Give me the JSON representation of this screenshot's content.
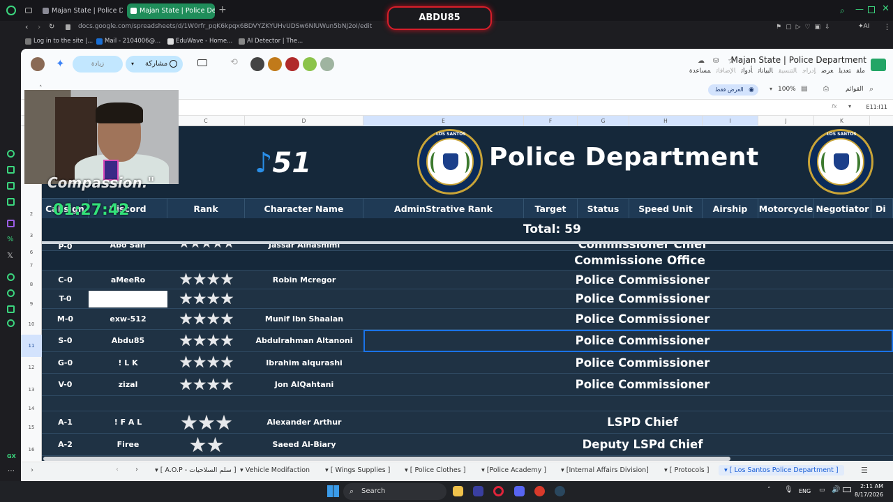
{
  "browser": {
    "tabs": [
      {
        "label": "Majan State | Police Depart",
        "active": false
      },
      {
        "label": "Majan State | Police Depart",
        "active": true
      }
    ],
    "url": "docs.google.com/spreadsheets/d/1W0rfr_pqK6kpqx6BDVYZKYUHvUDSw6NlUWun5bNJ2oI/edit",
    "bookmarks": [
      "Log in to the site |...",
      "Mail - 2104006@...",
      "EduWave - Home...",
      "AI Detector | The..."
    ],
    "stream_name": "ABDU85"
  },
  "sheet": {
    "doc_title": "Majan State | Police Department",
    "menus": [
      "ملف",
      "تعديل",
      "عرض",
      "إدراج",
      "التنسيق",
      "البيانات",
      "أدوات",
      "الإضافات",
      "مساعدة"
    ],
    "share_label": "مشاركة",
    "activity_label": "زيادة",
    "view_only_label": "العرض فقط",
    "zoom": "100%",
    "menus_label": "القوائم",
    "name_box": "E11:I11",
    "col_letters": [
      "C",
      "D",
      "E",
      "F",
      "G",
      "H",
      "I",
      "J",
      "K"
    ],
    "banner_title": "Police Department",
    "seal_text": "LOS SANTOS",
    "logo_text": "51",
    "headers": [
      "Callsign",
      "Discord",
      "Rank",
      "Character Name",
      "AdminStrative Rank",
      "Target",
      "Status",
      "Speed Unit",
      "Airship",
      "Motorcycle",
      "Negotiator",
      "Di"
    ],
    "total_label": "Total: 59",
    "rows": [
      {
        "num": "6",
        "callsign": "P-0",
        "discord": "Abo Saif",
        "stars": "★★★★★",
        "name": "Jassar Alhashimi",
        "title": "Commissioner Chief"
      },
      {
        "num": "7",
        "callsign": "",
        "discord": "",
        "stars": "",
        "name": "",
        "title": "Commissione Office"
      },
      {
        "num": "8",
        "callsign": "C-0",
        "discord": "aMeeRo",
        "stars": "★★★★",
        "name": "Robin Mcregor",
        "title": "Police Commissioner"
      },
      {
        "num": "9",
        "callsign": "T-0",
        "discord": "",
        "stars": "★★★★",
        "name": "",
        "title": "Police Commissioner"
      },
      {
        "num": "10",
        "callsign": "M-0",
        "discord": "exw-512",
        "stars": "★★★★",
        "name": "Munif Ibn Shaalan",
        "title": "Police Commissioner"
      },
      {
        "num": "11",
        "callsign": "S-0",
        "discord": "Abdu85",
        "stars": "★★★★",
        "name": "Abdulrahman Altanoni",
        "title": "Police Commissioner"
      },
      {
        "num": "12",
        "callsign": "G-0",
        "discord": "! L K",
        "stars": "★★★★",
        "name": "Ibrahim alqurashi",
        "title": "Police Commissioner"
      },
      {
        "num": "13",
        "callsign": "V-0",
        "discord": "zizal",
        "stars": "★★★★",
        "name": "Jon AlQahtani",
        "title": "Police Commissioner"
      },
      {
        "num": "14",
        "callsign": "",
        "discord": "",
        "stars": "",
        "name": "",
        "title": ""
      },
      {
        "num": "15",
        "callsign": "A-1",
        "discord": "! F A L",
        "stars": "★★★",
        "name": "Alexander Arthur",
        "title": "LSPD Chief"
      },
      {
        "num": "16",
        "callsign": "A-2",
        "discord": "Firee",
        "stars": "★★",
        "name": "Saeed Al-Biary",
        "title": "Deputy LSPd Chief"
      }
    ],
    "sheet_tabs": [
      "[ A.O.P - سلم السلاحيات ]",
      "Vehicle Modifaction",
      "[ Wings Supplies ]",
      "[ Police Clothes ]",
      "[Police Academy ]",
      "[Internal Affairs Division]",
      "[ Protocols ]",
      "[ Los Santos Police Department ]"
    ]
  },
  "overlay": {
    "timer": "01:27:42",
    "quote": "Compassion.\""
  },
  "taskbar": {
    "search_label": "Search",
    "lang": "ENG",
    "time": "2:11 AM",
    "date": "8/17/2026"
  }
}
